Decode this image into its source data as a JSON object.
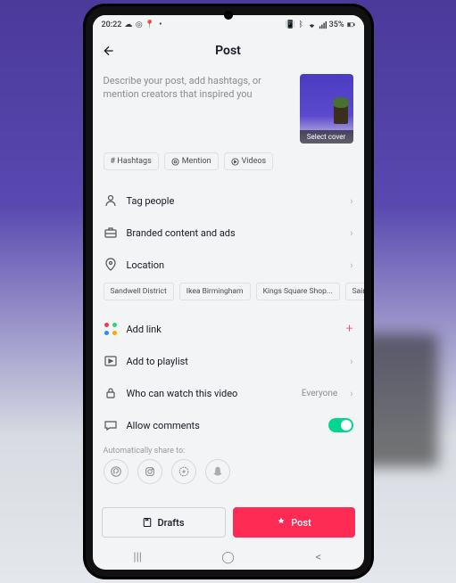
{
  "status": {
    "time": "20:22",
    "battery": "35%"
  },
  "header": {
    "title": "Post"
  },
  "description_placeholder": "Describe your post, add hashtags, or mention creators that inspired you",
  "cover": {
    "label": "Select cover"
  },
  "chips": {
    "hashtags": "# Hashtags",
    "mention": "Mention",
    "videos": "Videos"
  },
  "rows": {
    "tag_people": "Tag people",
    "branded": "Branded content and ads",
    "location": "Location",
    "add_link": "Add link",
    "add_playlist": "Add to playlist",
    "who_watch": "Who can watch this video",
    "who_watch_value": "Everyone",
    "allow_comments": "Allow comments"
  },
  "locations": [
    "Sandwell District",
    "Ikea Birmingham",
    "Kings Square Shop...",
    "Sainsb"
  ],
  "share": {
    "label": "Automatically share to:"
  },
  "buttons": {
    "drafts": "Drafts",
    "post": "Post"
  }
}
